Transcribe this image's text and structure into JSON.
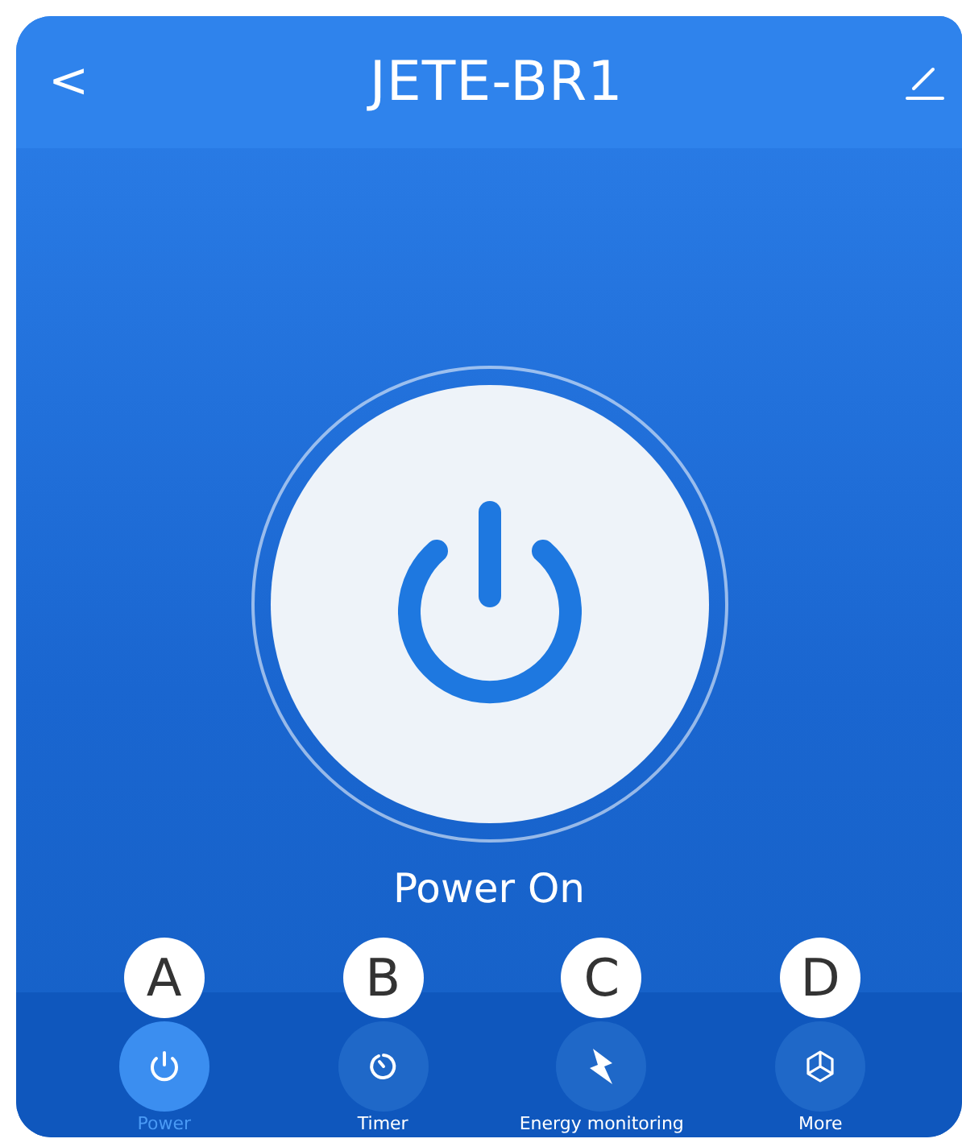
{
  "header": {
    "back": "<",
    "title": "JETE-BR1"
  },
  "power": {
    "on": true,
    "status": "Power On"
  },
  "tabs": [
    {
      "kind": "power",
      "label": "Power",
      "badge": "A",
      "selected": true
    },
    {
      "kind": "timer",
      "label": "Timer",
      "badge": "B",
      "selected": false
    },
    {
      "kind": "energy",
      "label": "Energy monitoring",
      "badge": "C",
      "selected": false
    },
    {
      "kind": "more",
      "label": "More",
      "badge": "D",
      "selected": false
    }
  ]
}
